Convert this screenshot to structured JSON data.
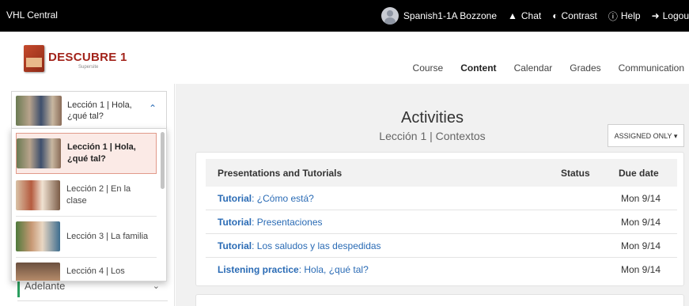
{
  "topbar": {
    "brand": "VHL Central",
    "user": "Spanish1-1A Bozzone",
    "chat": "Chat",
    "contrast": "Contrast",
    "help": "Help",
    "logout": "Logou"
  },
  "header": {
    "logo_text": "DESCUBRE 1",
    "logo_sub": "Supersite",
    "nav": [
      "Course",
      "Content",
      "Calendar",
      "Grades",
      "Communication"
    ],
    "active_nav": "Content"
  },
  "sidebar": {
    "selected_lesson": "Lección 1 | Hola, ¿qué tal?",
    "dropdown_items": [
      {
        "label": "Lección 1 | Hola, ¿qué tal?",
        "selected": true
      },
      {
        "label": "Lección 2 | En la clase",
        "selected": false
      },
      {
        "label": "Lección 3 | La familia",
        "selected": false
      },
      {
        "label": "Lección 4 | Los",
        "selected": false
      }
    ],
    "section_below": "Adelante"
  },
  "main": {
    "title": "Activities",
    "subtitle": "Lección 1 | Contextos",
    "filter": "ASSIGNED ONLY",
    "table": {
      "headers": [
        "Presentations and Tutorials",
        "Status",
        "Due date"
      ],
      "rows": [
        {
          "type": "Tutorial",
          "name": "¿Cómo está?",
          "due": "Mon 9/14"
        },
        {
          "type": "Tutorial",
          "name": "Presentaciones",
          "due": "Mon 9/14"
        },
        {
          "type": "Tutorial",
          "name": "Los saludos y las despedidas",
          "due": "Mon 9/14"
        },
        {
          "type": "Listening practice",
          "name": "Hola, ¿qué tal?",
          "due": "Mon 9/14"
        }
      ]
    }
  },
  "colors": {
    "accent_link": "#2a6bb5",
    "brand_red": "#a2231a",
    "selected_bg": "#fbeae6",
    "green_bar": "#2b9e5f"
  },
  "icons": [
    "user-avatar-icon",
    "chat-icon",
    "contrast-icon",
    "help-icon",
    "logout-icon",
    "chevron-up-icon",
    "chevron-down-icon",
    "caret-down-icon"
  ]
}
